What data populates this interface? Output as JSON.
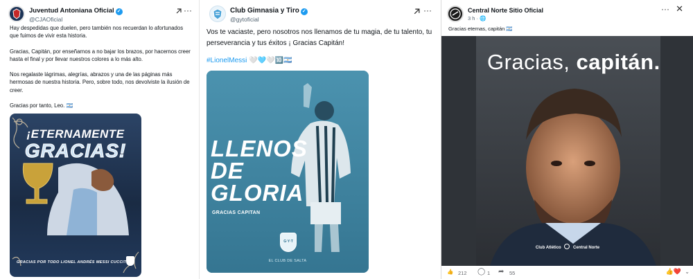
{
  "posts": [
    {
      "author": "Juventud Antoniana Oficial",
      "handle": "@CJAOficial",
      "paragraphs": [
        "Hay despedidas que duelen, pero también nos recuerdan lo afortunados que fuimos de vivir esta historia.",
        "Gracias, Capitán, por enseñarnos a no bajar los brazos, por hacernos creer hasta el final y por llevar nuestros colores a lo más alto.",
        "Nos regalaste lágrimas, alegrías, abrazos y una de las páginas más hermosas de nuestra historia. Pero, sobre todo, nos devolviste la ilusión de creer.",
        "Gracias por tanto, Leo. 🇦🇷"
      ],
      "image": {
        "headline_1": "¡ETERNAMENTE",
        "headline_2": "GRACIAS!",
        "caption": "GRACIAS POR TODO LIONEL ANDRÉS MESSI CUCCITTINI"
      },
      "colors": {
        "image_bg": "#1a2b44",
        "accent": "#cfe4f5"
      }
    },
    {
      "author": "Club Gimnasia y Tiro",
      "handle": "@gytoficial",
      "text": "Vos te vaciaste, pero nosotros nos llenamos de tu magia, de tu talento, tu perseverancia y tus éxitos ¡ Gracias Capitán!",
      "hashtag": "#LionelMessi",
      "emojis": "🤍🩵🤍🔟🇦🇷",
      "image": {
        "line_1": "LLENOS",
        "line_2": "DE",
        "line_3": "GLORIA",
        "caption": "GRACIAS CAPITAN",
        "badge": "G·Y·T",
        "footer": "EL CLUB DE SALTA"
      },
      "colors": {
        "image_bg": "#3f8aa7",
        "hashtag": "#1d9bf0"
      }
    },
    {
      "author": "Central Norte Sitio Oficial",
      "meta": "3 h · 🌐",
      "text": "Gracias eternas, capitán 🇦🇷",
      "image": {
        "title_light": "Gracias,",
        "title_bold": "capitán.",
        "footer_left": "Club Atlético",
        "footer_right": "Central Norte"
      },
      "stats": {
        "reactions": "212",
        "comments": "1",
        "shares": "55"
      },
      "colors": {
        "image_bg": "#3b3f44"
      }
    }
  ]
}
